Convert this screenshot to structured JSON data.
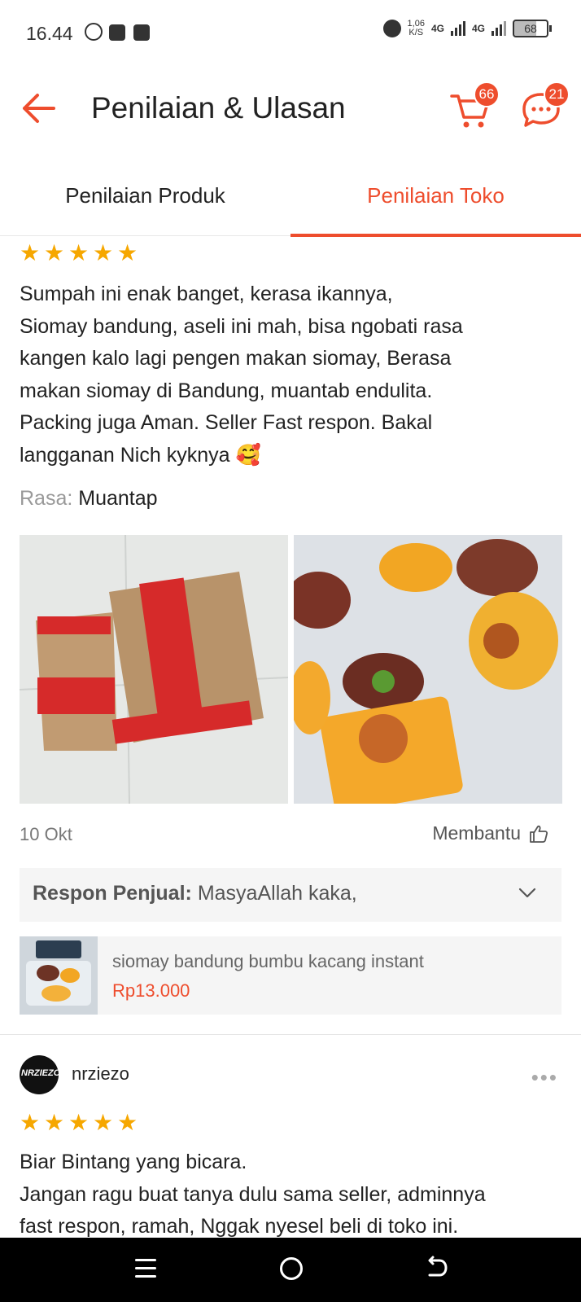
{
  "status_bar": {
    "time": "16.44",
    "speed_top": "1,06",
    "speed_unit": "K/S",
    "network1": "4G",
    "network2": "4G",
    "battery": "68"
  },
  "header": {
    "title": "Penilaian & Ulasan",
    "cart_badge": "66",
    "chat_badge": "21"
  },
  "tabs": [
    {
      "label": "Penilaian Produk",
      "active": false
    },
    {
      "label": "Penilaian Toko",
      "active": true
    }
  ],
  "review1": {
    "rating": 5,
    "text": "Sumpah ini enak banget, kerasa ikannya,\nSiomay bandung, aseli ini mah, bisa ngobati rasa\nkangen kalo lagi pengen makan siomay, Berasa\nmakan siomay di Bandung, muantab endulita.\nPacking juga Aman. Seller Fast respon. Bakal\nlangganan Nich kyknya 🥰",
    "attr_label": "Rasa:",
    "attr_value": "Muantap",
    "date": "10 Okt",
    "helpful_label": "Membantu",
    "seller_reply_label": "Respon Penjual:",
    "seller_reply_text": "MasyaAllah kaka,",
    "product_name": "siomay bandung bumbu kacang instant",
    "product_price": "Rp13.000"
  },
  "review2": {
    "username": "nrziezo",
    "avatar_text": "NRZIEZO",
    "more_label": "•••",
    "rating": 5,
    "text": "Biar Bintang yang bicara.\nJangan ragu buat tanya dulu sama seller, adminnya\nfast respon, ramah, Nggak nyesel beli di toko ini."
  },
  "colors": {
    "accent": "#ee4d2d",
    "star": "#f6a700"
  },
  "icons": [
    "back-arrow-icon",
    "cart-icon",
    "chat-icon",
    "chevron-down-icon",
    "thumbs-up-icon",
    "star-icon",
    "more-icon"
  ]
}
